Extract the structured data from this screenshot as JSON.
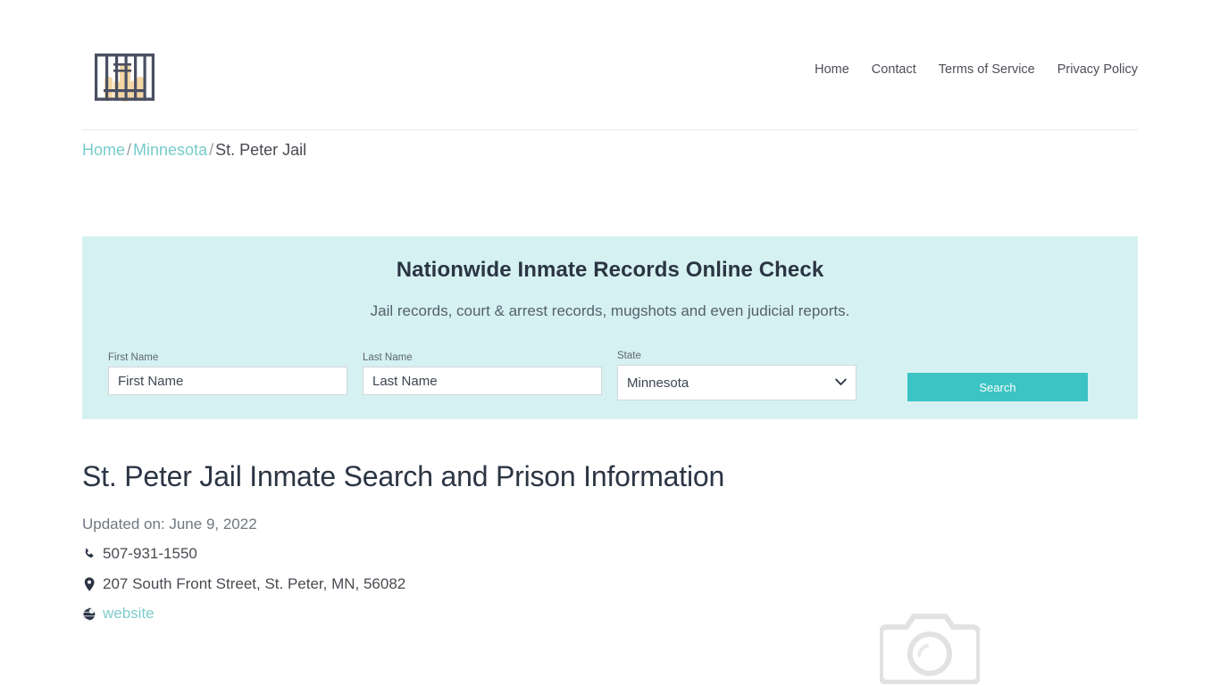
{
  "site": {
    "logo_icon": "jail-bars-hands-icon",
    "nav": [
      {
        "label": "Home"
      },
      {
        "label": "Contact"
      },
      {
        "label": "Terms of Service"
      },
      {
        "label": "Privacy Policy"
      }
    ]
  },
  "breadcrumb": {
    "items": [
      {
        "label": "Home",
        "link": true
      },
      {
        "label": "Minnesota",
        "link": true
      },
      {
        "label": "St. Peter Jail",
        "link": false
      }
    ],
    "separator": "/"
  },
  "search_banner": {
    "title": "Nationwide Inmate Records Online Check",
    "subtitle": "Jail records, court & arrest records, mugshots and even judicial reports.",
    "first_name": {
      "label": "First Name",
      "placeholder": "First Name",
      "value": ""
    },
    "last_name": {
      "label": "Last Name",
      "placeholder": "Last Name",
      "value": ""
    },
    "state": {
      "label": "State",
      "selected": "Minnesota",
      "chevron_icon": "chevron-down-icon"
    },
    "search_button": "Search",
    "background_color": "#d6f1f2",
    "button_color": "#3cc3c3"
  },
  "main": {
    "title": "St. Peter Jail Inmate Search and Prison Information",
    "updated": "Updated on: June 9, 2022",
    "phone": {
      "icon": "phone-icon",
      "value": "507-931-1550"
    },
    "address": {
      "icon": "map-pin-icon",
      "value": "207 South Front Street, St. Peter, MN, 56082"
    },
    "website": {
      "icon": "globe-icon",
      "label": "website"
    },
    "image_placeholder_icon": "camera-placeholder-icon"
  }
}
